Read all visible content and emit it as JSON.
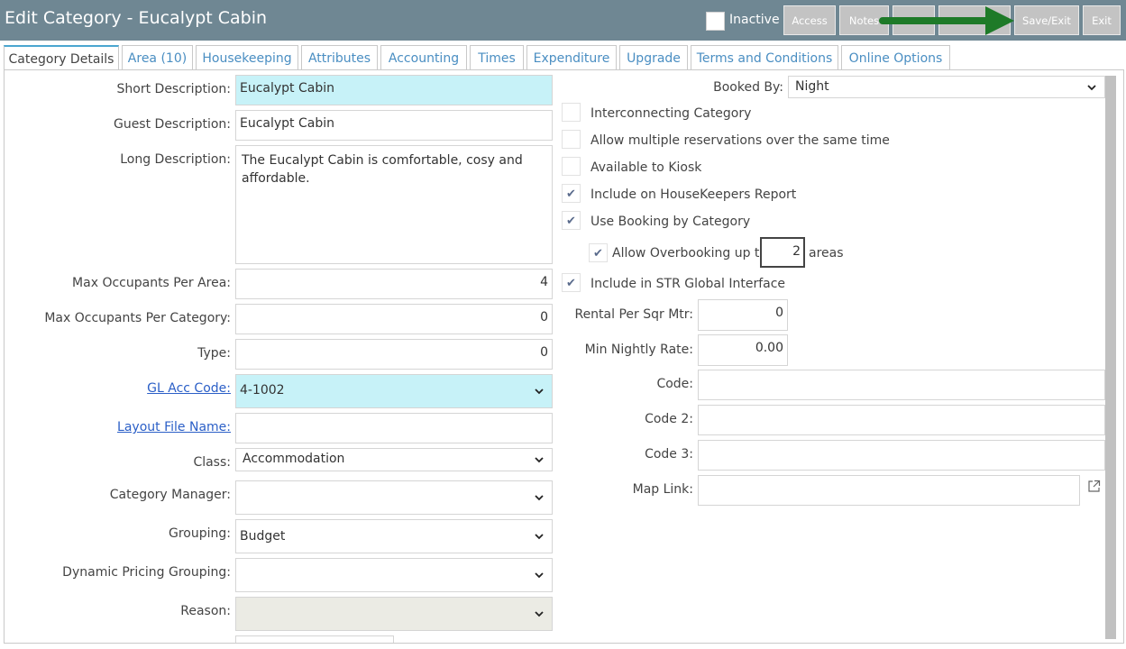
{
  "header": {
    "title": "Edit Category - Eucalypt Cabin",
    "inactive_label": "Inactive",
    "buttons": {
      "access": "Access",
      "notes": "Notes",
      "save_exit": "Save/Exit",
      "exit": "Exit"
    }
  },
  "tabs": [
    {
      "label": "Category Details"
    },
    {
      "label": "Area (10)"
    },
    {
      "label": "Housekeeping"
    },
    {
      "label": "Attributes"
    },
    {
      "label": "Accounting"
    },
    {
      "label": "Times"
    },
    {
      "label": "Expenditure"
    },
    {
      "label": "Upgrade"
    },
    {
      "label": "Terms and Conditions"
    },
    {
      "label": "Online Options"
    }
  ],
  "left": {
    "short_description": {
      "label": "Short Description:",
      "value": "Eucalypt Cabin"
    },
    "guest_description": {
      "label": "Guest Description:",
      "value": "Eucalypt Cabin"
    },
    "long_description": {
      "label": "Long Description:",
      "value": "The Eucalypt Cabin is comfortable, cosy and affordable."
    },
    "max_occ_area": {
      "label": "Max Occupants Per Area:",
      "value": "4"
    },
    "max_occ_category": {
      "label": "Max Occupants Per Category:",
      "value": "0"
    },
    "type": {
      "label": "Type:",
      "value": "0"
    },
    "gl_acc_code": {
      "label": "GL Acc Code:",
      "value": "4-1002"
    },
    "layout_file": {
      "label": "Layout File Name:",
      "value": ""
    },
    "class": {
      "label": "Class:",
      "value": "Accommodation"
    },
    "category_manager": {
      "label": "Category Manager:",
      "value": ""
    },
    "grouping": {
      "label": "Grouping:",
      "value": "Budget"
    },
    "dynamic_pricing": {
      "label": "Dynamic Pricing Grouping:",
      "value": ""
    },
    "reason": {
      "label": "Reason:",
      "value": ""
    }
  },
  "right": {
    "booked_by": {
      "label": "Booked By:",
      "value": "Night"
    },
    "checkboxes": [
      {
        "label": "Interconnecting Category",
        "checked": false
      },
      {
        "label": "Allow multiple reservations over the same time",
        "checked": false
      },
      {
        "label": "Available to Kiosk",
        "checked": false
      },
      {
        "label": "Include on HouseKeepers Report",
        "checked": true
      },
      {
        "label": "Use Booking by Category",
        "checked": true
      }
    ],
    "overbooking": {
      "label": "Allow Overbooking up to",
      "value": "2",
      "suffix": "areas",
      "checked": true
    },
    "str_global": {
      "label": "Include in STR Global Interface",
      "checked": true
    },
    "rental_sqm": {
      "label": "Rental Per Sqr Mtr:",
      "value": "0"
    },
    "min_nightly": {
      "label": "Min Nightly Rate:",
      "value": "0.00"
    },
    "code": {
      "label": "Code:",
      "value": ""
    },
    "code2": {
      "label": "Code 2:",
      "value": ""
    },
    "code3": {
      "label": "Code 3:",
      "value": ""
    },
    "map_link": {
      "label": "Map Link:",
      "value": ""
    }
  },
  "colors": {
    "header_bg": "#6f8793",
    "highlight": "#c7f2f8",
    "link": "#2b5fc7",
    "arrow": "#1e7a28"
  },
  "icons": {
    "external_link": "external-link-icon",
    "chevron": "chevron-down-icon",
    "check": "check-icon"
  }
}
